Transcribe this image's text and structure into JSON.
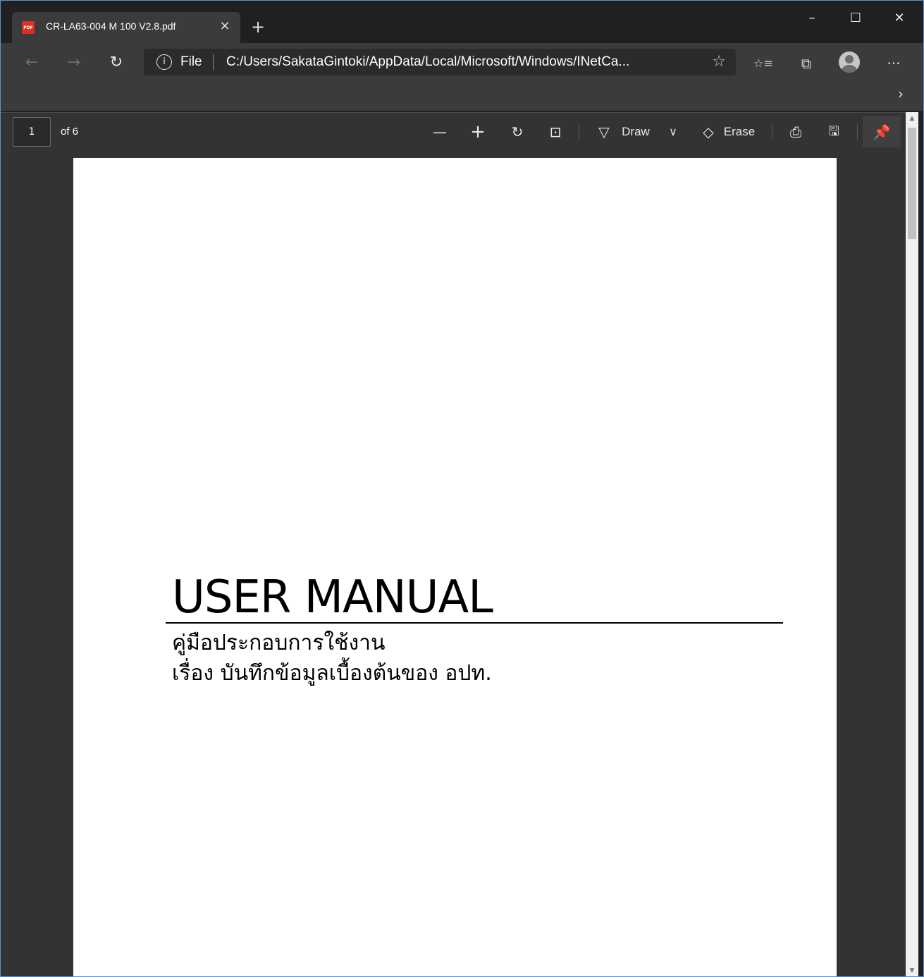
{
  "browser": {
    "tab": {
      "icon": "pdf-file-icon",
      "title": "CR-LA63-004 M 100 V2.8.pdf",
      "close": "×"
    },
    "new_tab": "+",
    "window_controls": {
      "minimize": "–",
      "maximize": "☐",
      "close": "✕"
    },
    "nav": {
      "back": "←",
      "forward": "→",
      "refresh": "↻"
    },
    "address": {
      "info_icon": "i",
      "scheme_label": "File",
      "url": "C:/Users/SakataGintoki/AppData/Local/Microsoft/Windows/INetCa...",
      "favorite_icon": "☆"
    },
    "toolbar_icons": {
      "favorites": "☆≡",
      "collections": "⧉",
      "more": "···"
    },
    "favorites_overflow": "›"
  },
  "pdf_toolbar": {
    "page_number": "1",
    "page_count": "of 6",
    "zoom_out": "—",
    "zoom_in": "+",
    "rotate": "↻",
    "fit": "⊡",
    "draw_label": "Draw",
    "draw_icon": "▽",
    "draw_dropdown": "∨",
    "erase_label": "Erase",
    "erase_icon": "◇",
    "print": "⎙",
    "save": "🖫",
    "pin": "📌"
  },
  "document": {
    "title": "USER MANUAL",
    "subtitle_line1": "คู่มือประกอบการใช้งาน",
    "subtitle_line2": "เรื่อง บันทึกข้อมูลเบื้องต้นของ อปท."
  },
  "scrollbar": {
    "up": "▲",
    "down": "▼"
  },
  "colors": {
    "chrome_bg": "#202020",
    "toolbar_bg": "#3b3b3b",
    "viewer_bg": "#333333",
    "page_bg": "#ffffff",
    "pdf_icon": "#d93025"
  }
}
